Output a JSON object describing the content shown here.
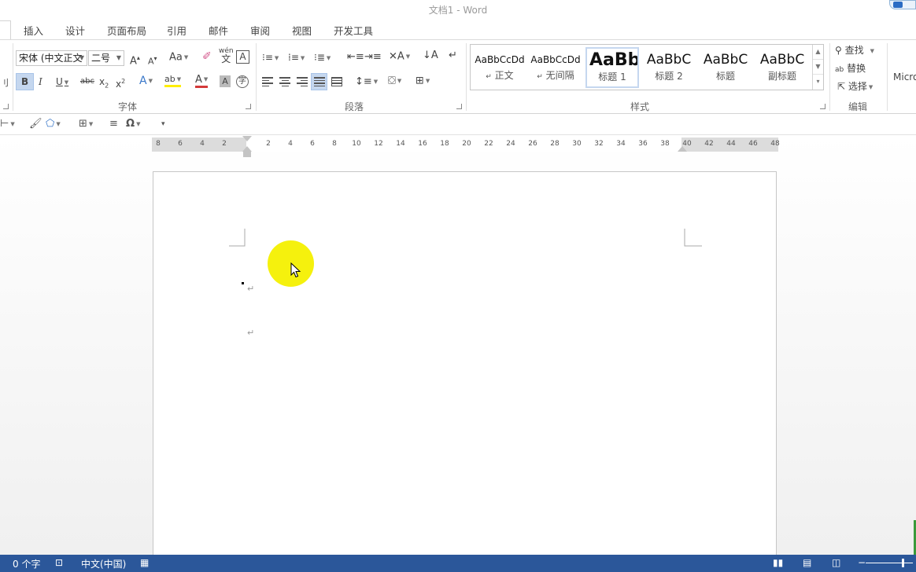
{
  "window": {
    "title": "文档1 - Word"
  },
  "tabs": [
    "插入",
    "设计",
    "页面布局",
    "引用",
    "邮件",
    "审阅",
    "视图",
    "开发工具"
  ],
  "font_group": {
    "font_name": "宋体 (中文正文",
    "font_size": "二号",
    "grow_label": "A",
    "shrink_label": "A",
    "case_label": "Aa",
    "phonetic_label": "wén",
    "phonetic_sub": "文",
    "border_char_label": "A",
    "bold": "B",
    "italic": "I",
    "underline": "U",
    "strike": "abc",
    "subscript": "x",
    "superscript": "x",
    "text_effect": "A",
    "highlight": "ab",
    "font_color": "A",
    "shading": "A",
    "enclose": "字",
    "label": "字体"
  },
  "paragraph_group": {
    "label": "段落"
  },
  "styles_group": {
    "label": "样式",
    "items": [
      {
        "sample": "AaBbCcDd",
        "name": "正文",
        "mark": "↵"
      },
      {
        "sample": "AaBbCcDd",
        "name": "无间隔",
        "mark": "↵"
      },
      {
        "sample": "AaBb",
        "name": "标题 1"
      },
      {
        "sample": "AaBbC",
        "name": "标题 2"
      },
      {
        "sample": "AaBbC",
        "name": "标题"
      },
      {
        "sample": "AaBbC",
        "name": "副标题"
      }
    ]
  },
  "editing_group": {
    "find": "查找",
    "replace": "替换",
    "select": "选择",
    "label": "编辑"
  },
  "cut_off_right": "Micro",
  "ruler": {
    "ticks": [
      "8",
      "6",
      "4",
      "2",
      "2",
      "4",
      "6",
      "8",
      "10",
      "12",
      "14",
      "16",
      "18",
      "20",
      "22",
      "24",
      "26",
      "28",
      "30",
      "32",
      "34",
      "36",
      "38",
      "40",
      "42",
      "44",
      "46",
      "48"
    ]
  },
  "document": {
    "paragraph_mark": "↵"
  },
  "statusbar": {
    "word_count": "0 个字",
    "language": "中文(中国)"
  },
  "colors": {
    "statusbar": "#2b579a",
    "cursor_highlight": "#f4f000",
    "selection": "#c5d7ef"
  }
}
